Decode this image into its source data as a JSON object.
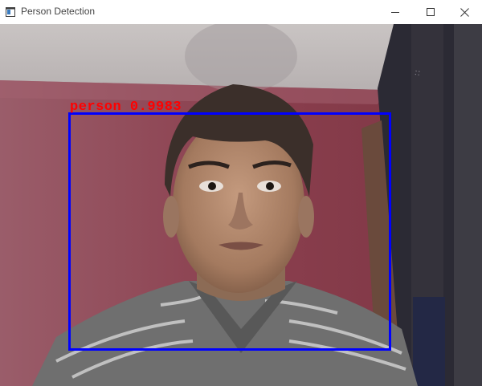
{
  "window": {
    "title": "Person Detection",
    "icon": "app-window-icon",
    "controls": [
      "minimize-icon",
      "maximize-icon",
      "close-icon"
    ]
  },
  "detection": {
    "class_label": "person",
    "confidence": "0.9983",
    "box_color": "#0000ff",
    "label_color": "#ff0000"
  }
}
